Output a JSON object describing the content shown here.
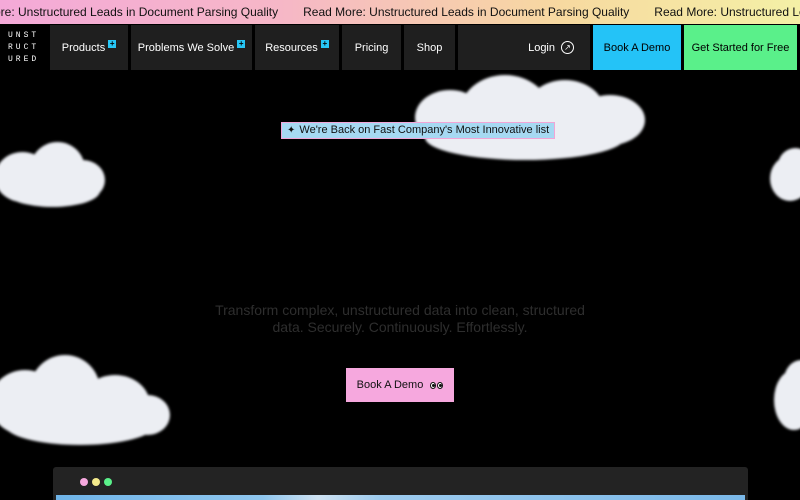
{
  "ticker": {
    "items": [
      "ore: Unstructured Leads in Document Parsing Quality",
      "Read More: Unstructured Leads in Document Parsing Quality",
      "Read More: Unstructured Leads in Document Parsing Quality"
    ]
  },
  "logo": {
    "lines": [
      "UNST",
      "RUCT",
      "URED"
    ]
  },
  "nav": {
    "products": "Products",
    "problems": "Problems We Solve",
    "resources": "Resources",
    "pricing": "Pricing",
    "shop": "Shop",
    "login": "Login",
    "book_demo": "Book A Demo",
    "get_started": "Get Started for Free"
  },
  "badge": {
    "text": "We're Back on Fast Company's Most Innovative list"
  },
  "hero": {
    "tagline_line1": "Transform complex, unstructured data into clean, structured",
    "tagline_line2": "data. Securely. Continuously. Effortlessly.",
    "cta": "Book A Demo"
  },
  "colors": {
    "accent_blue": "#24c3f7",
    "accent_green": "#5af08a",
    "accent_pink": "#f6a8de",
    "window_dots": [
      "#f6a8de",
      "#f4ea8c",
      "#5af08a"
    ]
  }
}
